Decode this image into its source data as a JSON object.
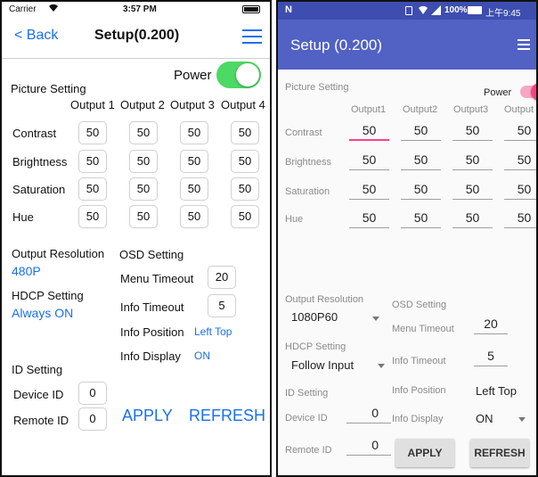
{
  "ios": {
    "status": {
      "carrier": "Carrier",
      "time": "3:57 PM"
    },
    "nav": {
      "back_label": "Back",
      "title": "Setup(0.200)"
    },
    "picture_setting_label": "Picture Setting",
    "power_label": "Power",
    "power_on": true,
    "outputs": [
      "Output 1",
      "Output 2",
      "Output 3",
      "Output 4"
    ],
    "rows": [
      {
        "label": "Contrast",
        "values": [
          "50",
          "50",
          "50",
          "50"
        ]
      },
      {
        "label": "Brightness",
        "values": [
          "50",
          "50",
          "50",
          "50"
        ]
      },
      {
        "label": "Saturation",
        "values": [
          "50",
          "50",
          "50",
          "50"
        ]
      },
      {
        "label": "Hue",
        "values": [
          "50",
          "50",
          "50",
          "50"
        ]
      }
    ],
    "output_resolution_label": "Output Resolution",
    "output_resolution_value": "480P",
    "hdcp_label": "HDCP Setting",
    "hdcp_value": "Always ON",
    "osd_label": "OSD Setting",
    "menu_timeout_label": "Menu Timeout",
    "menu_timeout_value": "20",
    "info_timeout_label": "Info Timeout",
    "info_timeout_value": "5",
    "info_position_label": "Info Position",
    "info_position_value": "Left Top",
    "info_display_label": "Info Display",
    "info_display_value": "ON",
    "id_setting_label": "ID Setting",
    "device_id_label": "Device ID",
    "device_id_value": "0",
    "remote_id_label": "Remote ID",
    "remote_id_value": "0",
    "apply_label": "APPLY",
    "refresh_label": "REFRESH"
  },
  "android": {
    "status": {
      "battery": "100%",
      "time": "上午9:45"
    },
    "title": "Setup (0.200)",
    "picture_setting_label": "Picture Setting",
    "power_label": "Power",
    "power_on": true,
    "outputs": [
      "Output1",
      "Output2",
      "Output3",
      "Output"
    ],
    "rows": [
      {
        "label": "Contrast",
        "values": [
          "50",
          "50",
          "50",
          "50"
        ]
      },
      {
        "label": "Brightness",
        "values": [
          "50",
          "50",
          "50",
          "50"
        ]
      },
      {
        "label": "Saturation",
        "values": [
          "50",
          "50",
          "50",
          "50"
        ]
      },
      {
        "label": "Hue",
        "values": [
          "50",
          "50",
          "50",
          "50"
        ]
      }
    ],
    "output_resolution_label": "Output Resolution",
    "output_resolution_value": "1080P60",
    "osd_label": "OSD Setting",
    "menu_timeout_label": "Menu Timeout",
    "menu_timeout_value": "20",
    "hdcp_label": "HDCP Setting",
    "hdcp_value": "Follow Input",
    "info_timeout_label": "Info Timeout",
    "info_timeout_value": "5",
    "id_setting_label": "ID Setting",
    "info_position_label": "Info Position",
    "info_position_value": "Left Top",
    "device_id_label": "Device ID",
    "device_id_value": "0",
    "info_display_label": "Info Display",
    "info_display_value": "ON",
    "remote_id_label": "Remote ID",
    "remote_id_value": "0",
    "apply_label": "APPLY",
    "refresh_label": "REFRESH"
  },
  "colors": {
    "ios_blue": "#1a6ff0",
    "ios_switch": "#4cd964",
    "android_primary": "#5161c4",
    "android_status": "#3d4eb0",
    "android_accent": "#ff4081"
  }
}
